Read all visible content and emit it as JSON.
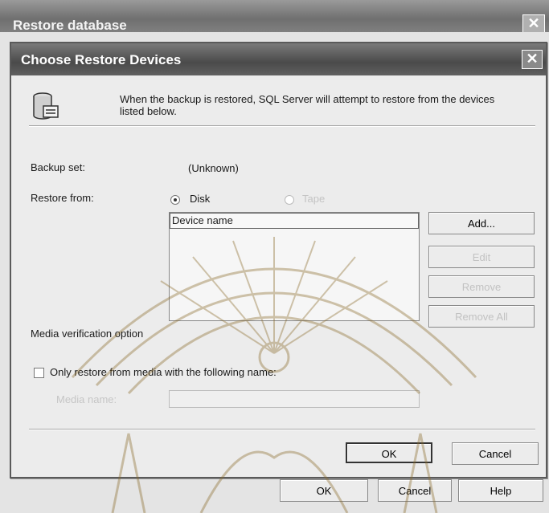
{
  "outer_window": {
    "title": "Restore database",
    "close_glyph": "✕",
    "buttons": {
      "ok": "OK",
      "cancel": "Cancel",
      "help": "Help"
    }
  },
  "dialog": {
    "title": "Choose Restore Devices",
    "close_glyph": "✕",
    "icon": "database-icon",
    "intro_text": "When the backup is restored, SQL Server will attempt to restore from the devices listed below.",
    "backup_set": {
      "label": "Backup set:",
      "value": "(Unknown)"
    },
    "restore_from": {
      "label": "Restore from:",
      "options": [
        {
          "label": "Disk",
          "selected": true,
          "enabled": true
        },
        {
          "label": "Tape",
          "selected": false,
          "enabled": false
        }
      ]
    },
    "device_list": {
      "header": "Device name",
      "items": []
    },
    "device_buttons": {
      "add": "Add...",
      "edit": "Edit",
      "remove": "Remove",
      "remove_all": "Remove All"
    },
    "media_verification": {
      "section_label": "Media verification option",
      "checkbox_label": "Only restore from media with the following name:",
      "checked": false,
      "media_name_label": "Media name:",
      "media_name_value": ""
    },
    "buttons": {
      "ok": "OK",
      "cancel": "Cancel"
    }
  }
}
